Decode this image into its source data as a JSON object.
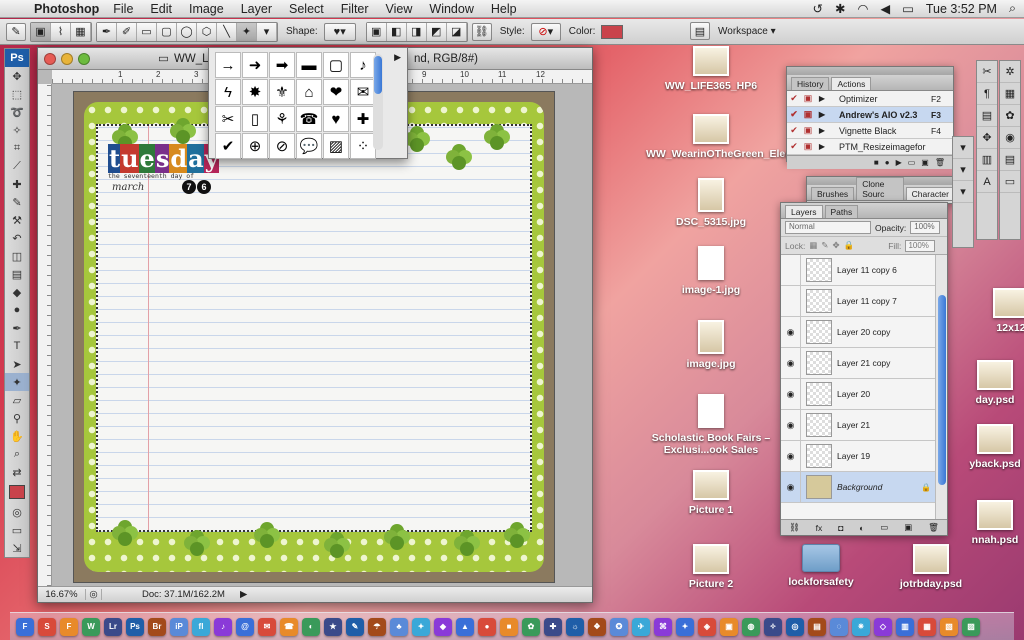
{
  "menubar": {
    "app": "Photoshop",
    "menus": [
      "File",
      "Edit",
      "Image",
      "Layer",
      "Select",
      "Filter",
      "View",
      "Window",
      "Help"
    ],
    "clock": "Tue 3:52 PM"
  },
  "options_bar": {
    "shape_label": "Shape:",
    "style_label": "Style:",
    "color_label": "Color:",
    "color_value": "#c9434b",
    "workspace_label": "Workspace"
  },
  "document": {
    "title": "WW_LI",
    "title_suffix": "nd, RGB/8#)",
    "zoom": "16.67%",
    "doc_size": "Doc: 37.1M/162.2M",
    "ruler_numbers": [
      "1",
      "2",
      "3",
      "4",
      "5",
      "6",
      "7",
      "8",
      "9",
      "10",
      "11",
      "12"
    ],
    "canvas": {
      "word_letters": [
        "t",
        "u",
        "e",
        "s",
        "d",
        "a",
        "y"
      ],
      "letter_colors": [
        "#1f4d8f",
        "#c43a2f",
        "#2f7a3a",
        "#7a2f8a",
        "#d78a1e",
        "#1f6f9c",
        "#b8265a"
      ],
      "subtitle": "the seventeenth day of",
      "month": "march",
      "day_digits": [
        "7",
        "6"
      ]
    }
  },
  "shape_picker": {
    "shapes": [
      "→",
      "➜",
      "➡",
      "▬",
      "▢",
      "♪",
      "ϟ",
      "✸",
      "⚜",
      "⌂",
      "❤",
      "✉",
      "✂",
      "▯",
      "⚘",
      "☎",
      "♥",
      "✚",
      "✔",
      "⊕",
      "⊘",
      "💬",
      "▨",
      "⁘"
    ]
  },
  "actions_panel": {
    "tabs": [
      "History",
      "Actions"
    ],
    "rows": [
      {
        "name": "Optimizer",
        "key": "F2",
        "selected": false
      },
      {
        "name": "Andrew's AIO v2.3",
        "key": "F3",
        "selected": true
      },
      {
        "name": "Vignette Black",
        "key": "F4",
        "selected": false
      },
      {
        "name": "PTM_Resizeimagefor",
        "key": "",
        "selected": false
      }
    ]
  },
  "brushes_panel": {
    "tabs": [
      "Brushes",
      "Clone Sourc",
      "Character"
    ]
  },
  "layers_panel": {
    "tabs": [
      "Layers",
      "Paths"
    ],
    "blend_mode": "Normal",
    "opacity_label": "Opacity:",
    "opacity_value": "100%",
    "lock_label": "Lock:",
    "fill_label": "Fill:",
    "fill_value": "100%",
    "layers": [
      {
        "name": "Layer 11 copy 6",
        "visible": false,
        "selected": false,
        "bg": false
      },
      {
        "name": "Layer 11 copy 7",
        "visible": false,
        "selected": false,
        "bg": false
      },
      {
        "name": "Layer 20 copy",
        "visible": true,
        "selected": false,
        "bg": false
      },
      {
        "name": "Layer 21 copy",
        "visible": true,
        "selected": false,
        "bg": false
      },
      {
        "name": "Layer 20",
        "visible": true,
        "selected": false,
        "bg": false
      },
      {
        "name": "Layer 21",
        "visible": true,
        "selected": false,
        "bg": false
      },
      {
        "name": "Layer 19",
        "visible": true,
        "selected": false,
        "bg": false
      },
      {
        "name": "Background",
        "visible": true,
        "selected": true,
        "bg": true
      }
    ]
  },
  "desktop_icons": [
    {
      "label": "WW_LIFE365_HP6",
      "kind": "img"
    },
    {
      "label": "WW_WearinOTheGreen_Elements",
      "kind": "img"
    },
    {
      "label": "DSC_5315.jpg",
      "kind": "tall"
    },
    {
      "label": "image-1.jpg",
      "kind": "pdf"
    },
    {
      "label": "image.jpg",
      "kind": "tall"
    },
    {
      "label": "Scholastic Book Fairs – Exclusi...ook Sales",
      "kind": "pdf"
    },
    {
      "label": "Picture 1",
      "kind": "img"
    },
    {
      "label": "Picture 2",
      "kind": "img"
    },
    {
      "label": "lockforsafety",
      "kind": "folder"
    },
    {
      "label": "jotrbday.psd",
      "kind": "img"
    },
    {
      "label": "12x12",
      "kind": "img"
    },
    {
      "label": "day.psd",
      "kind": "img"
    },
    {
      "label": "yback.psd",
      "kind": "img"
    },
    {
      "label": "nnah.psd",
      "kind": "img"
    }
  ],
  "dock_apps": [
    "F",
    "S",
    "F",
    "W",
    "Lr",
    "Ps",
    "Br",
    "iP",
    "fl",
    "♪",
    "@",
    "✉",
    "☎",
    "◐",
    "★",
    "✎",
    "☂",
    "♣",
    "✦",
    "◆",
    "▲",
    "●",
    "■",
    "✿",
    "✚",
    "☼",
    "❖",
    "✪",
    "✈",
    "⌘",
    "✦",
    "◈",
    "▣",
    "◍",
    "✧",
    "◎",
    "▤",
    "◌",
    "✷",
    "◇",
    "▥",
    "▦",
    "▧",
    "▨"
  ]
}
